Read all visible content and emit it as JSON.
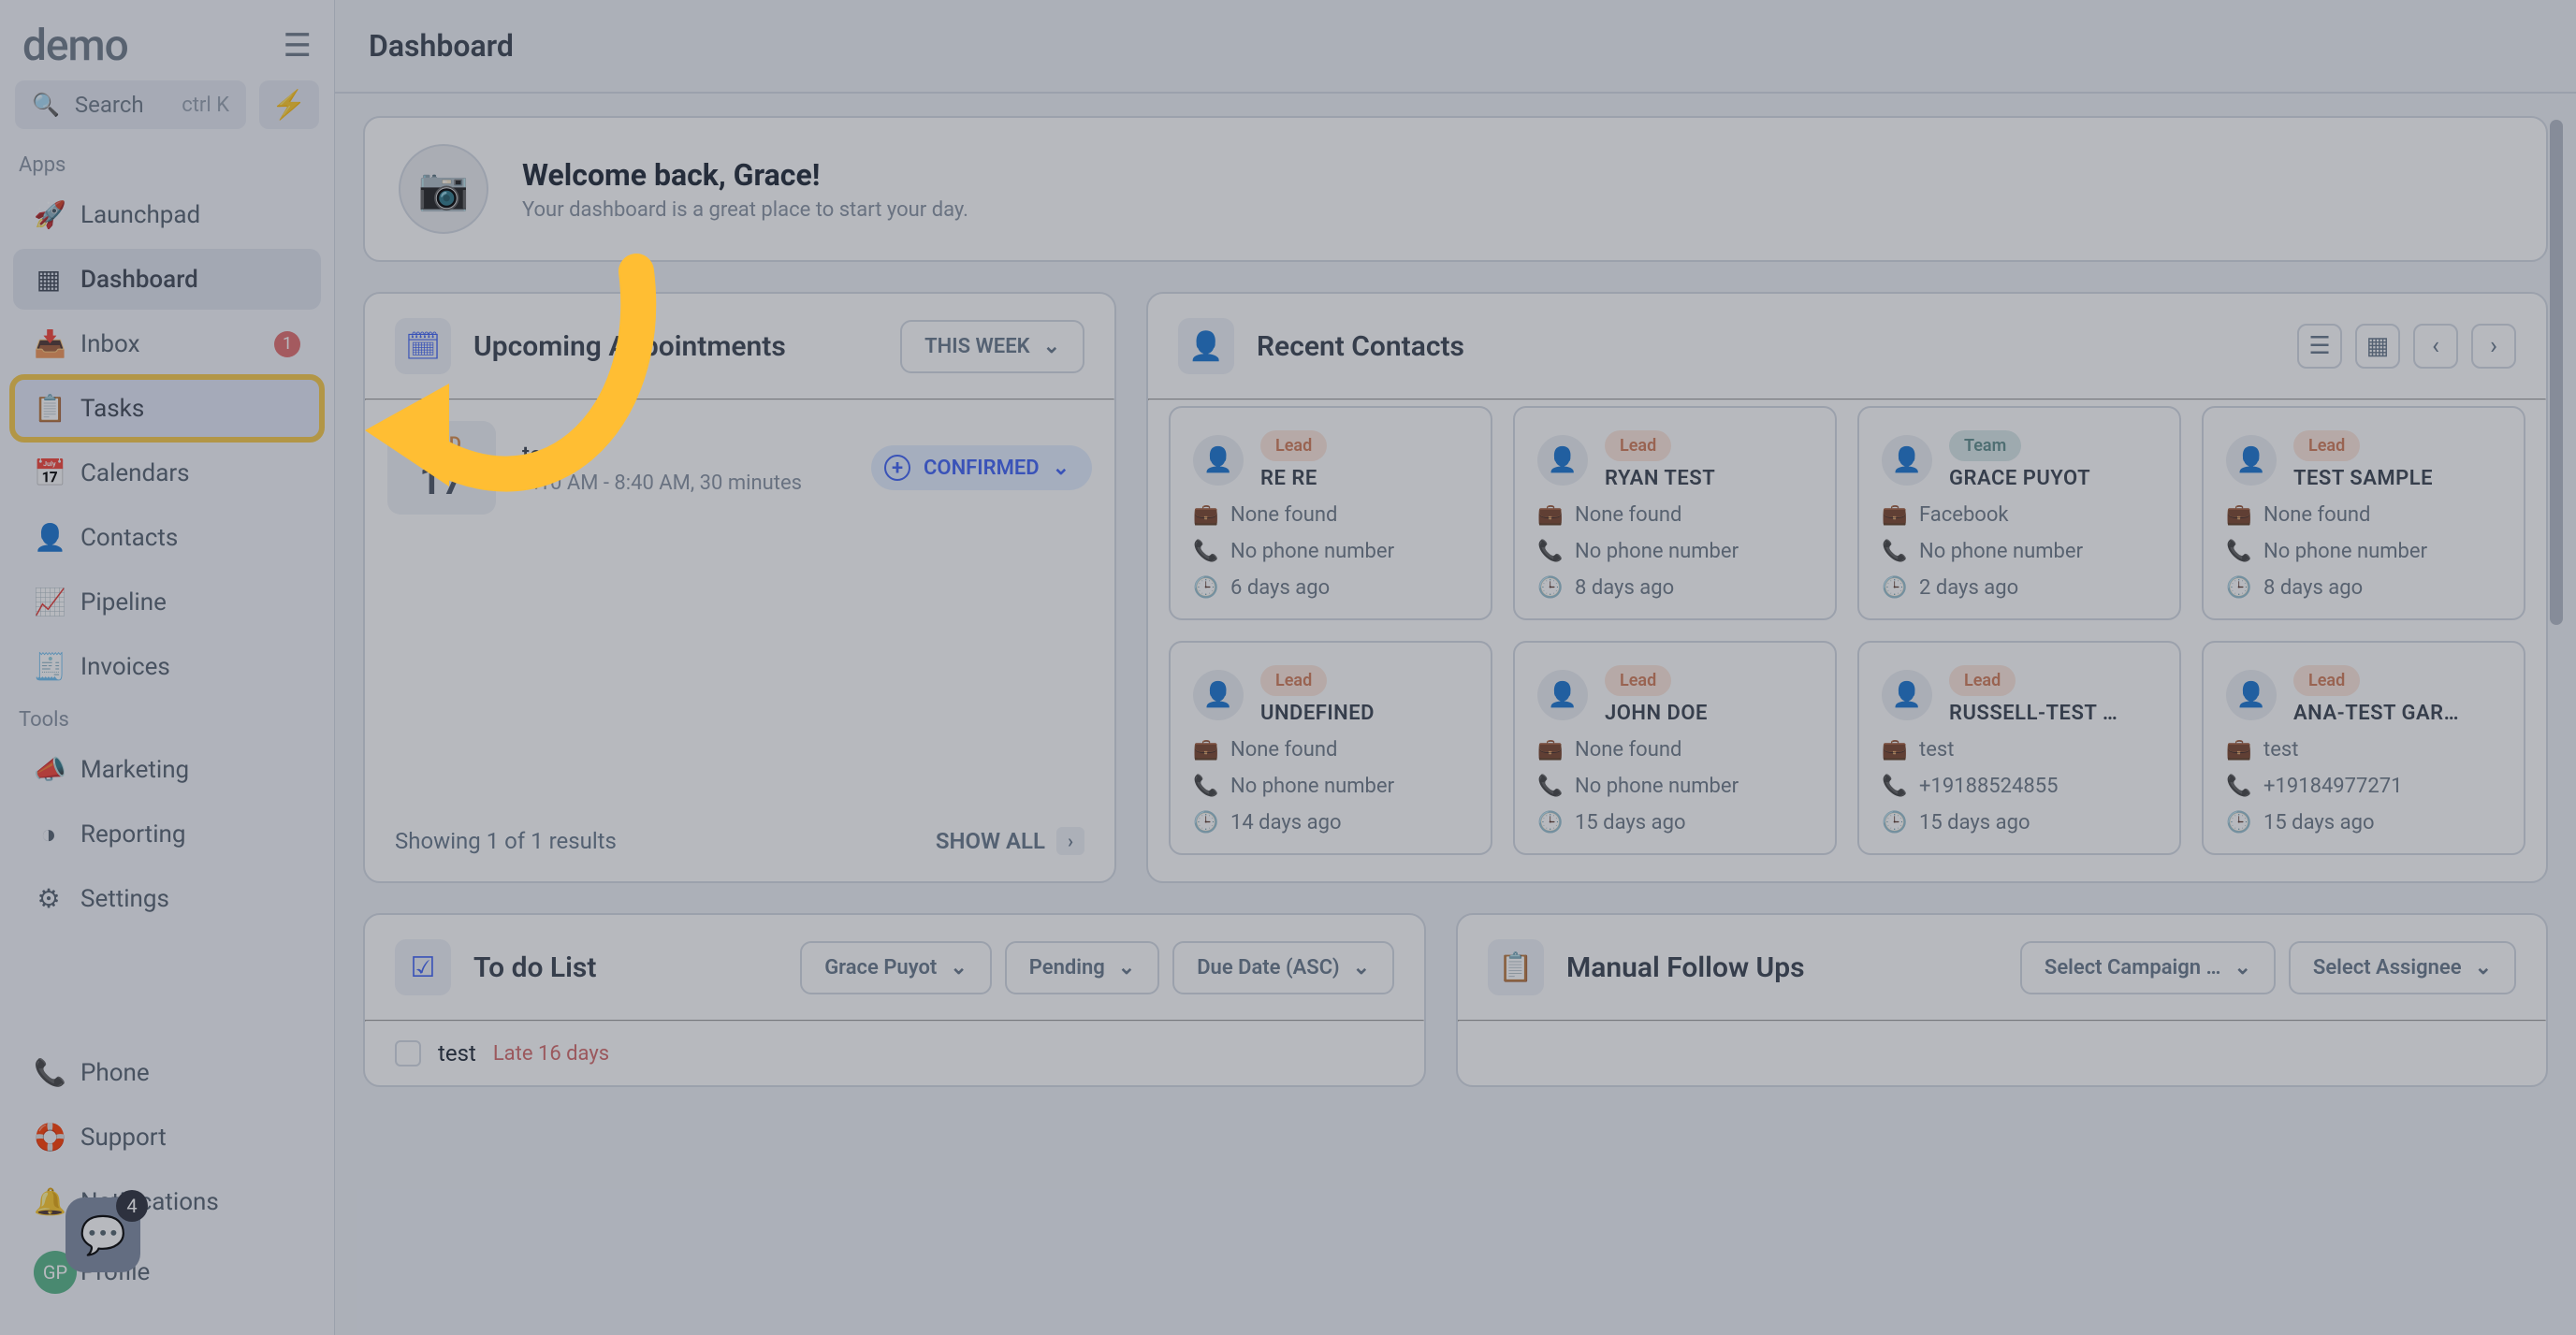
{
  "brand": "demo",
  "search": {
    "placeholder": "Search",
    "shortcut": "ctrl K"
  },
  "sections": {
    "apps": "Apps",
    "tools": "Tools"
  },
  "nav_apps": [
    {
      "icon": "🚀",
      "label": "Launchpad"
    },
    {
      "icon": "▦",
      "label": "Dashboard",
      "active": true
    },
    {
      "icon": "📥",
      "label": "Inbox",
      "badge": "1"
    },
    {
      "icon": "📋",
      "label": "Tasks",
      "highlight": true
    },
    {
      "icon": "📅",
      "label": "Calendars"
    },
    {
      "icon": "👤",
      "label": "Contacts"
    },
    {
      "icon": "📈",
      "label": "Pipeline"
    },
    {
      "icon": "🧾",
      "label": "Invoices"
    }
  ],
  "nav_tools": [
    {
      "icon": "📣",
      "label": "Marketing"
    },
    {
      "icon": "◑",
      "label": "Reporting"
    },
    {
      "icon": "⚙",
      "label": "Settings"
    }
  ],
  "nav_bottom": [
    {
      "icon": "📞",
      "label": "Phone"
    },
    {
      "icon": "🛟",
      "label": "Support"
    },
    {
      "icon": "🔔",
      "label": "Notifications"
    },
    {
      "icon": "avatar",
      "label": "Profile",
      "initials": "GP"
    }
  ],
  "chat_badge": "4",
  "page_title": "Dashboard",
  "welcome": {
    "title": "Welcome back, Grace!",
    "subtitle": "Your dashboard is a great place to start your day."
  },
  "appts": {
    "heading": "Upcoming Appointments",
    "range": "THIS WEEK",
    "items": [
      {
        "dow": "WED",
        "day": "17",
        "title": "test",
        "time": "8:10 AM - 8:40 AM, 30 minutes",
        "status": "CONFIRMED"
      }
    ],
    "footer": "Showing 1 of 1 results",
    "showall": "SHOW ALL"
  },
  "contacts": {
    "heading": "Recent Contacts",
    "cards": [
      {
        "type": "Lead",
        "name": "RE RE",
        "company": "None found",
        "phone": "No phone number",
        "age": "6 days ago"
      },
      {
        "type": "Lead",
        "name": "RYAN TEST",
        "company": "None found",
        "phone": "No phone number",
        "age": "8 days ago"
      },
      {
        "type": "Team",
        "name": "GRACE PUYOT",
        "company": "Facebook",
        "phone": "No phone number",
        "age": "2 days ago"
      },
      {
        "type": "Lead",
        "name": "TEST SAMPLE",
        "company": "None found",
        "phone": "No phone number",
        "age": "8 days ago"
      },
      {
        "type": "Lead",
        "name": "UNDEFINED",
        "company": "None found",
        "phone": "No phone number",
        "age": "14 days ago"
      },
      {
        "type": "Lead",
        "name": "JOHN DOE",
        "company": "None found",
        "phone": "No phone number",
        "age": "15 days ago"
      },
      {
        "type": "Lead",
        "name": "RUSSELL-TEST …",
        "company": "test",
        "phone": "+19188524855",
        "age": "15 days ago"
      },
      {
        "type": "Lead",
        "name": "ANA-TEST GAR…",
        "company": "test",
        "phone": "+19184977271",
        "age": "15 days ago"
      }
    ]
  },
  "todo": {
    "heading": "To do List",
    "filters": {
      "assignee": "Grace Puyot",
      "status": "Pending",
      "sort": "Due Date (ASC)"
    },
    "items": [
      {
        "title": "test",
        "late": "Late 16 days"
      }
    ]
  },
  "follow": {
    "heading": "Manual Follow Ups",
    "filters": {
      "campaign": "Select Campaign …",
      "assignee": "Select Assignee"
    }
  }
}
